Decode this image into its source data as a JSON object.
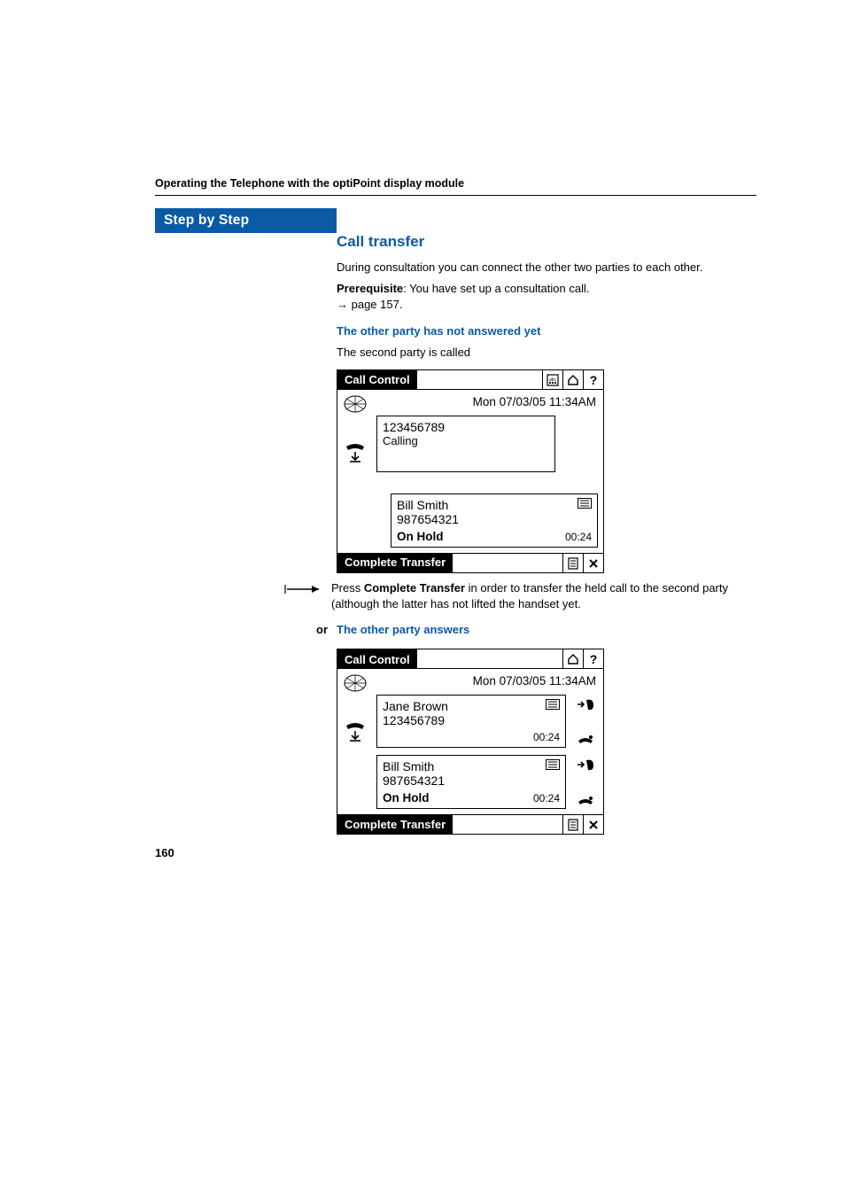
{
  "running_header": "Operating the Telephone with the optiPoint display module",
  "step_banner": "Step by Step",
  "h2": "Call transfer",
  "intro": "During consultation you can connect the other two parties to each other.",
  "prereq_label": "Prerequisite",
  "prereq_text": ": You have set up a consultation call.",
  "prereq_ref": " page 157.",
  "h3_a": "The other party has not answered yet",
  "line_a": "The second party is called",
  "screen1": {
    "title": "Call Control",
    "datetime": "Mon 07/03/05 11:34AM",
    "calling": {
      "number": "123456789",
      "status": "Calling"
    },
    "held": {
      "name": "Bill Smith",
      "number": "987654321",
      "status": "On Hold",
      "timer": "00:24"
    },
    "footer_btn": "Complete Transfer"
  },
  "press_prefix": "Press ",
  "press_bold": "Complete Transfer",
  "press_suffix": " in order to transfer the held call to the second party (although the latter has not lifted the handset yet.",
  "or_label": "or",
  "h3_b": "The other party answers",
  "screen2": {
    "title": "Call Control",
    "datetime": "Mon 07/03/05 11:34AM",
    "active": {
      "name": "Jane Brown",
      "number": "123456789",
      "timer": "00:24"
    },
    "held": {
      "name": "Bill Smith",
      "number": "987654321",
      "status": "On Hold",
      "timer": "00:24"
    },
    "footer_btn": "Complete Transfer"
  },
  "page_number": "160"
}
